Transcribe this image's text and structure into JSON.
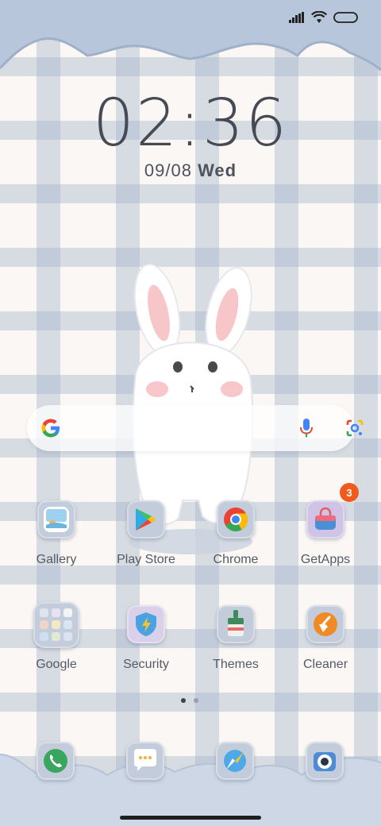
{
  "status_bar": {
    "signal_icon": "signal-icon",
    "wifi_icon": "wifi-icon",
    "battery_icon": "battery-icon"
  },
  "lock": {
    "time": "02:36",
    "date": "09/08",
    "weekday": "Wed"
  },
  "search": {
    "google_icon": "google-g-icon",
    "mic_icon": "mic-icon",
    "lens_icon": "lens-icon"
  },
  "apps_row1": [
    {
      "label": "Gallery",
      "icon": "gallery-icon"
    },
    {
      "label": "Play Store",
      "icon": "play-store-icon"
    },
    {
      "label": "Chrome",
      "icon": "chrome-icon"
    },
    {
      "label": "GetApps",
      "icon": "getapps-icon",
      "badge": "3"
    }
  ],
  "apps_row2": [
    {
      "label": "Google",
      "icon": "folder-icon"
    },
    {
      "label": "Security",
      "icon": "security-icon"
    },
    {
      "label": "Themes",
      "icon": "themes-icon"
    },
    {
      "label": "Cleaner",
      "icon": "cleaner-icon"
    }
  ],
  "pages": {
    "count": 2,
    "active": 1
  },
  "dock": [
    {
      "name": "phone",
      "icon": "phone-icon"
    },
    {
      "name": "messages",
      "icon": "messages-icon"
    },
    {
      "name": "browser",
      "icon": "browser-icon"
    },
    {
      "name": "camera",
      "icon": "camera-icon"
    }
  ],
  "colors": {
    "accent_badge": "#f25a1d",
    "cloud": "#b8c6db",
    "grid": "#aab8cd"
  }
}
